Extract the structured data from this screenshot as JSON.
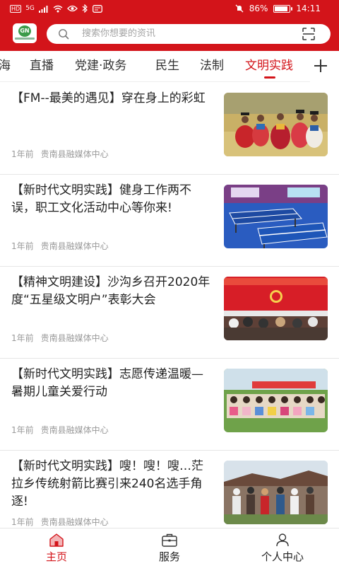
{
  "status_bar": {
    "signal_badge": "HD",
    "network": "5G",
    "battery_percent": "86%",
    "battery_level": 0.86,
    "time": "14:11"
  },
  "header": {
    "logo_text": "GN",
    "search_placeholder": "搜索你想要的资讯",
    "search_icon": "search-icon",
    "scan_icon": "scan-icon"
  },
  "tabs": [
    {
      "label": "海"
    },
    {
      "label": "直播"
    },
    {
      "label": "党建·政务"
    },
    {
      "label": "民生"
    },
    {
      "label": "法制"
    },
    {
      "label": "文明实践"
    }
  ],
  "active_tab": "文明实践",
  "articles": [
    {
      "title": "【FM--最美的遇见】穿在身上的彩虹",
      "time": "1年前",
      "source": "贵南县融媒体中心"
    },
    {
      "title": "【新时代文明实践】健身工作两不误，职工文化活动中心等你来!",
      "time": "1年前",
      "source": "贵南县融媒体中心"
    },
    {
      "title": "【精神文明建设】沙沟乡召开2020年度“五星级文明户”表彰大会",
      "time": "1年前",
      "source": "贵南县融媒体中心"
    },
    {
      "title": "【新时代文明实践】志愿传递温暖—暑期儿童关爱行动",
      "time": "1年前",
      "source": "贵南县融媒体中心"
    },
    {
      "title": "【新时代文明实践】嗖！嗖！嗖…茫拉乡传统射箭比赛引来240名选手角逐!",
      "time": "1年前",
      "source": "贵南县融媒体中心"
    }
  ],
  "bottom_nav": [
    {
      "label": "主页",
      "icon": "home-icon"
    },
    {
      "label": "服务",
      "icon": "briefcase-icon"
    },
    {
      "label": "个人中心",
      "icon": "person-icon"
    }
  ],
  "colors": {
    "brand_red": "#d3141a",
    "text": "#222222",
    "meta": "#9a9a9a"
  }
}
